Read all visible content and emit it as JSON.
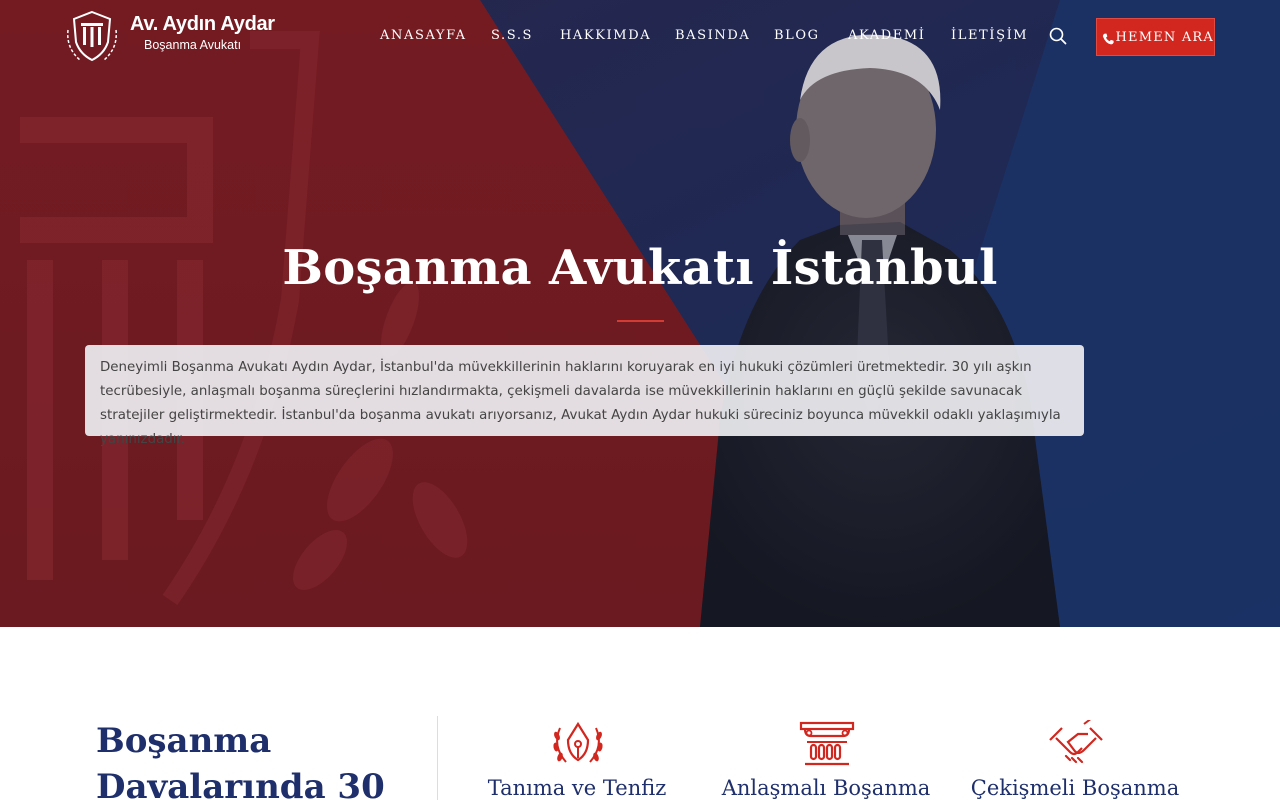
{
  "brand": {
    "name": "Av. Aydın Aydar",
    "subtitle": "Boşanma Avukatı"
  },
  "nav": {
    "items": [
      {
        "label": "ANASAYFA"
      },
      {
        "label": "S.S.S"
      },
      {
        "label": "HAKKIMDA"
      },
      {
        "label": "BASINDA"
      },
      {
        "label": "BLOG"
      },
      {
        "label": "AKADEMİ"
      },
      {
        "label": "İLETİŞİM"
      }
    ],
    "search_icon": "search-icon",
    "call_button_label": "HEMEN ARA",
    "call_icon": "phone-icon"
  },
  "hero": {
    "title": "Boşanma Avukatı İstanbul",
    "description": "Deneyimli Boşanma Avukatı Aydın Aydar, İstanbul'da müvekkillerinin haklarını koruyarak en iyi hukuki çözümleri üretmektedir. 30 yılı aşkın tecrübesiyle, anlaşmalı boşanma süreçlerini hızlandırmakta, çekişmeli davalarda ise müvekkillerinin haklarını en güçlü şekilde savunacak stratejiler geliştirmektedir. İstanbul'da boşanma avukatı arıyorsanız, Avukat Aydın Aydar hukuki süreciniz boyunca müvekkil odaklı yaklaşımıyla yanınızdadır."
  },
  "services_section": {
    "title": "Boşanma Davalarında 30",
    "services": [
      {
        "label": "Tanıma ve Tenfiz",
        "icon": "pen-nib-laurel-icon"
      },
      {
        "label": "Anlaşmalı Boşanma",
        "icon": "column-capital-icon"
      },
      {
        "label": "Çekişmeli Boşanma",
        "icon": "handshake-icon"
      }
    ]
  },
  "colors": {
    "accent_red": "#d1271f",
    "hero_red": "#6e1c22",
    "hero_navy": "#1b2a4e",
    "heading_navy": "#1f2f6b"
  }
}
